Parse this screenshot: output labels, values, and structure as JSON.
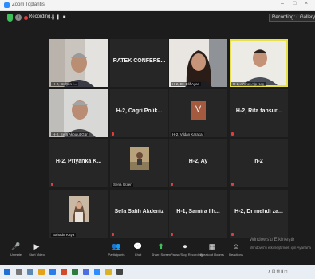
{
  "window": {
    "title": "Zoom Toplantısı",
    "controls": [
      "–",
      "□",
      "×"
    ]
  },
  "topbar": {
    "info": "i",
    "recording": "Recording...",
    "rec_controls": "❚❚ ■",
    "rec_button": "Recording: 01:02",
    "view_button": "Gallery"
  },
  "tiles": [
    {
      "name": "",
      "label": "H-2, Gülşen İ...",
      "photo": "man-grey",
      "active": false
    },
    {
      "name": "RATEK CONFERE...",
      "label": "",
      "photo": "",
      "active": false
    },
    {
      "name": "",
      "label": "H-2, Dr. Elif Ayan",
      "photo": "woman-dark-hair",
      "active": false
    },
    {
      "name": "",
      "label": "H-2, Ahmet Alp Koç",
      "photo": "man-white-wall",
      "active": true
    },
    {
      "name": "",
      "label": "H-2, Sefa Akbulut Gür",
      "photo": "man-grey-2",
      "active": false
    },
    {
      "name": "H-2, Cagri Polik...",
      "label": "",
      "photo": "",
      "active": false
    },
    {
      "name": "V",
      "label": "H-2, Vildan Karaca",
      "photo": "avatar-v",
      "active": false
    },
    {
      "name": "H-2, Rita tahsur...",
      "label": "",
      "photo": "",
      "active": false
    },
    {
      "name": "H-2, Priyanka K...",
      "label": "",
      "photo": "",
      "active": false
    },
    {
      "name": "",
      "label": "Sena Güler",
      "photo": "small-outdoor",
      "active": false
    },
    {
      "name": "H-2, Ay",
      "label": "",
      "photo": "",
      "active": false
    },
    {
      "name": "h-2",
      "label": "",
      "photo": "",
      "active": false
    },
    {
      "name": "",
      "label": "Bahadır Kaya",
      "photo": "small-portrait",
      "active": false
    },
    {
      "name": "Sefa Salih Akdeniz",
      "label": "",
      "photo": "",
      "active": false
    },
    {
      "name": "H-1, Samira Ilh...",
      "label": "",
      "photo": "",
      "active": false
    },
    {
      "name": "H-2, Dr mehdi za...",
      "label": "",
      "photo": "",
      "active": false
    }
  ],
  "bottombar": [
    {
      "icon": "microphone-icon",
      "glyph": "🎤",
      "label": "Unmute"
    },
    {
      "icon": "video-icon",
      "glyph": "▶",
      "label": "Start Video"
    },
    {
      "icon": "participants-icon",
      "glyph": "👥",
      "label": "Participants"
    },
    {
      "icon": "chat-icon",
      "glyph": "💬",
      "label": "Chat"
    },
    {
      "icon": "share-screen-icon",
      "glyph": "⬆",
      "label": "Share Screen"
    },
    {
      "icon": "recording-icon",
      "glyph": "⏺",
      "label": "Pause/Stop Recording"
    },
    {
      "icon": "breakout-rooms-icon",
      "glyph": "▦",
      "label": "Breakout Rooms"
    },
    {
      "icon": "reactions-icon",
      "glyph": "☺",
      "label": "Reactions"
    }
  ],
  "watermark": {
    "line1": "Windows'u Etkinleştir",
    "line2": "Windows'u etkinleştirmek için Ayarlar'a"
  },
  "taskbar": {
    "tray": "∧ ⊡ ✉ ▮ ◻"
  },
  "colors": {
    "meeting_bg": "#1c1c1c",
    "tile_bg": "#262626",
    "active_border": "#e6e04a",
    "mic_muted": "#e23c3c"
  }
}
